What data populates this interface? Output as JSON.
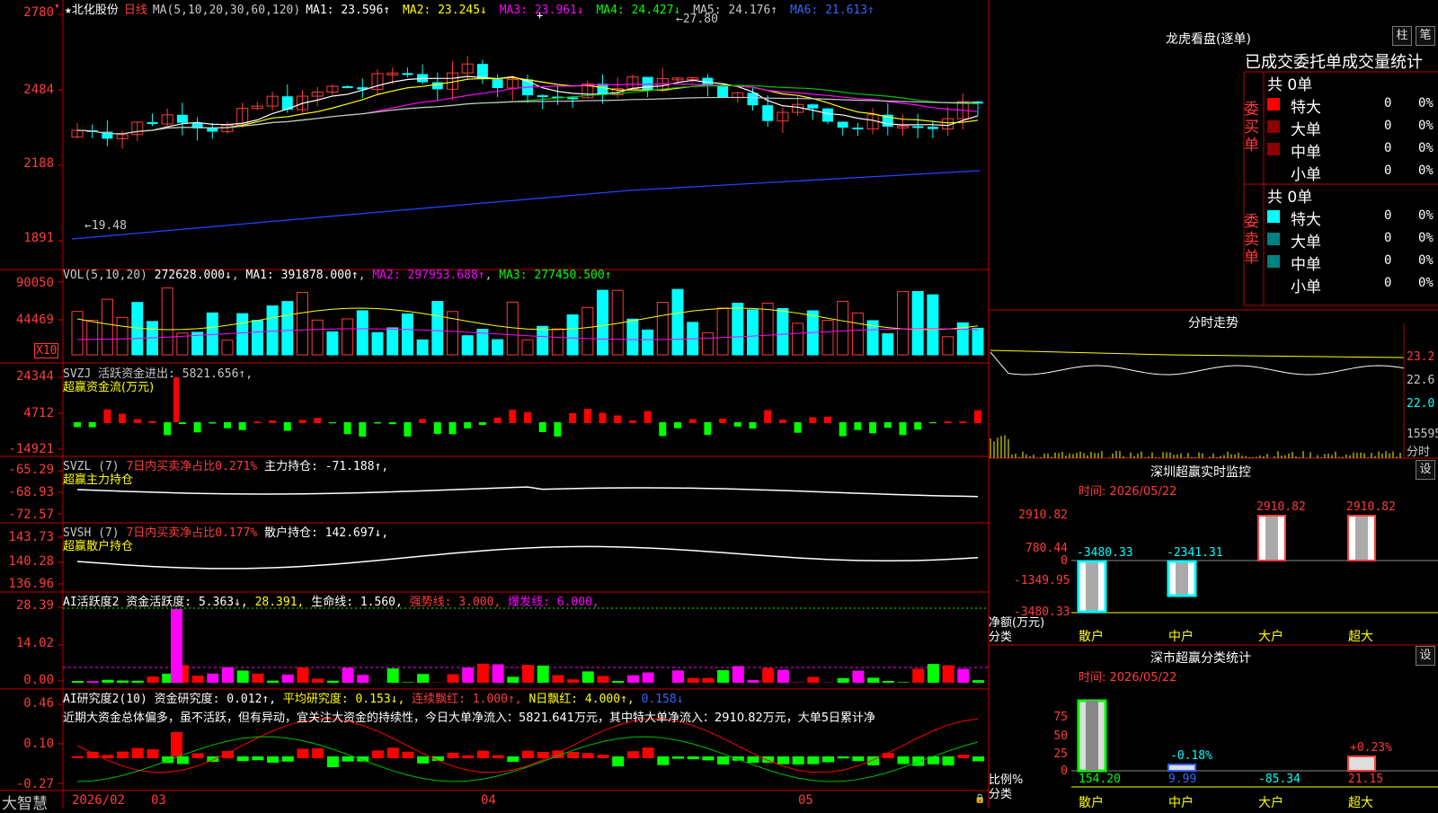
{
  "header": {
    "stock": "★北化股份",
    "period": "日线",
    "ma_title": "MA(5,10,20,30,60,120)",
    "ma": [
      {
        "label": "MA1:",
        "value": "23.596↑",
        "color": "#ffffff"
      },
      {
        "label": "MA2:",
        "value": "23.245↓",
        "color": "#ffff00"
      },
      {
        "label": "MA3:",
        "value": "23.961↓",
        "color": "#ff00ff"
      },
      {
        "label": "MA4:",
        "value": "24.427↓",
        "color": "#00ff00"
      },
      {
        "label": "MA5:",
        "value": "24.176↑",
        "color": "#c8c8c8"
      },
      {
        "label": "MA6:",
        "value": "21.613↑",
        "color": "#3366ff"
      }
    ],
    "high_mark": "27.80",
    "low_mark": "19.48"
  },
  "price_axis": [
    "2780",
    "2484",
    "2188",
    "1891"
  ],
  "vol_panel": {
    "title": "VOL(5,10,20)",
    "value": "272628.000↓",
    "ma1": "MA1: 391878.000↑",
    "ma2": "MA2: 297953.688↑",
    "ma3": "MA3: 277450.500↑",
    "axis": [
      "90050",
      "44469"
    ],
    "unit": "X10"
  },
  "svzj_panel": {
    "title": "SVZJ  活跃资金进出: 5821.656↑,",
    "sub": "超赢资金流(万元)",
    "axis": [
      "24344",
      "4712",
      "-14921"
    ]
  },
  "svzl_panel": {
    "title": "SVZL (7)",
    "ratio": "7日内买卖净占比0.271%",
    "hold": "主力持仓: -71.188↑,",
    "sub": "超赢主力持仓",
    "axis": [
      "-65.29",
      "-68.93",
      "-72.57"
    ]
  },
  "svsh_panel": {
    "title": "SVSH (7)",
    "ratio": "7日内买卖净占比0.177%",
    "hold": "散户持仓: 142.697↓,",
    "sub": "超赢散户持仓",
    "axis": [
      "143.73",
      "140.28",
      "136.96"
    ]
  },
  "ai_active": {
    "title": "AI活跃度2 资金活跃度: 5.363↓,",
    "v2": "28.391,",
    "life": "生命线: 1.560,",
    "strong": "强势线: 3.000,",
    "burst": "爆发线: 6.000,",
    "axis": [
      "28.39",
      "14.02",
      "0.00"
    ]
  },
  "ai_research": {
    "title": "AI研究度2(10) 资金研究度: 0.012↑,",
    "avg": "平均研究度: 0.153↓,",
    "red": "连续飘红: 1.000↑,",
    "nred": "N日飘红: 4.000↑,",
    "last": "0.158↓",
    "comment": "近期大资金总体偏多，虽不活跃，但有异动，宜关注大资金的持续性，今日大单净流入：5821.641万元，其中特大单净流入：2910.82万元，大单5日累计净",
    "axis": [
      "0.46",
      "0.10",
      "-0.27"
    ]
  },
  "bottom_axis": {
    "brand": "大智慧",
    "labels": [
      "2026/02",
      "03",
      "04",
      "05"
    ]
  },
  "right_panel": {
    "lhb_title": "龙虎看盘(逐单)",
    "btn1": "柱",
    "btn2": "笔",
    "stats_title": "已成交委托单成交量统计",
    "buy_side": "委买单",
    "sell_side": "委卖单",
    "buy_total": "共 0单",
    "sell_total": "共 0单",
    "buy_rows": [
      {
        "name": "特大",
        "count": "0",
        "pct": "0%",
        "color": "#ff0000"
      },
      {
        "name": "大单",
        "count": "0",
        "pct": "0%",
        "color": "#8b0000"
      },
      {
        "name": "中单",
        "count": "0",
        "pct": "0%",
        "color": "#8b0000"
      },
      {
        "name": "小单",
        "count": "0",
        "pct": "0%",
        "color": ""
      }
    ],
    "sell_rows": [
      {
        "name": "特大",
        "count": "0",
        "pct": "0%",
        "color": "#00ffff"
      },
      {
        "name": "大单",
        "count": "0",
        "pct": "0%",
        "color": "#008080"
      },
      {
        "name": "中单",
        "count": "0",
        "pct": "0%",
        "color": "#008080"
      },
      {
        "name": "小单",
        "count": "0",
        "pct": "0%",
        "color": ""
      }
    ],
    "intraday_title": "分时走势",
    "intraday_axis": [
      "23.2",
      "22.6",
      "22.0",
      "15595"
    ],
    "intraday_unit": "分时",
    "monitor_title": "深圳超赢实时监控",
    "monitor_btn": "设",
    "monitor_time": "时间: 2026/05/22",
    "monitor_axis": [
      "2910.82",
      "780.44",
      "0",
      "-1349.95",
      "-3480.33"
    ],
    "monitor_ylabel": "净额(万元)",
    "monitor_xlabel": "分类",
    "monitor_bars": [
      {
        "cat": "散户",
        "value": "-3480.33"
      },
      {
        "cat": "中户",
        "value": "-2341.31"
      },
      {
        "cat": "大户",
        "value": "2910.82"
      },
      {
        "cat": "超大",
        "value": "2910.82"
      }
    ],
    "class_title": "深市超赢分类统计",
    "class_btn": "设",
    "class_time": "时间: 2026/05/22",
    "class_axis": [
      "75",
      "50",
      "25",
      "0"
    ],
    "class_ylabel": "比例%",
    "class_xlabel": "分类",
    "class_bars": [
      {
        "cat": "散户",
        "value": "154.20",
        "pct": ""
      },
      {
        "cat": "中户",
        "value": "9.99",
        "pct": "-0.18%"
      },
      {
        "cat": "大户",
        "value": "-85.34",
        "pct": ""
      },
      {
        "cat": "超大",
        "value": "21.15",
        "pct": "+0.23%"
      }
    ]
  }
}
